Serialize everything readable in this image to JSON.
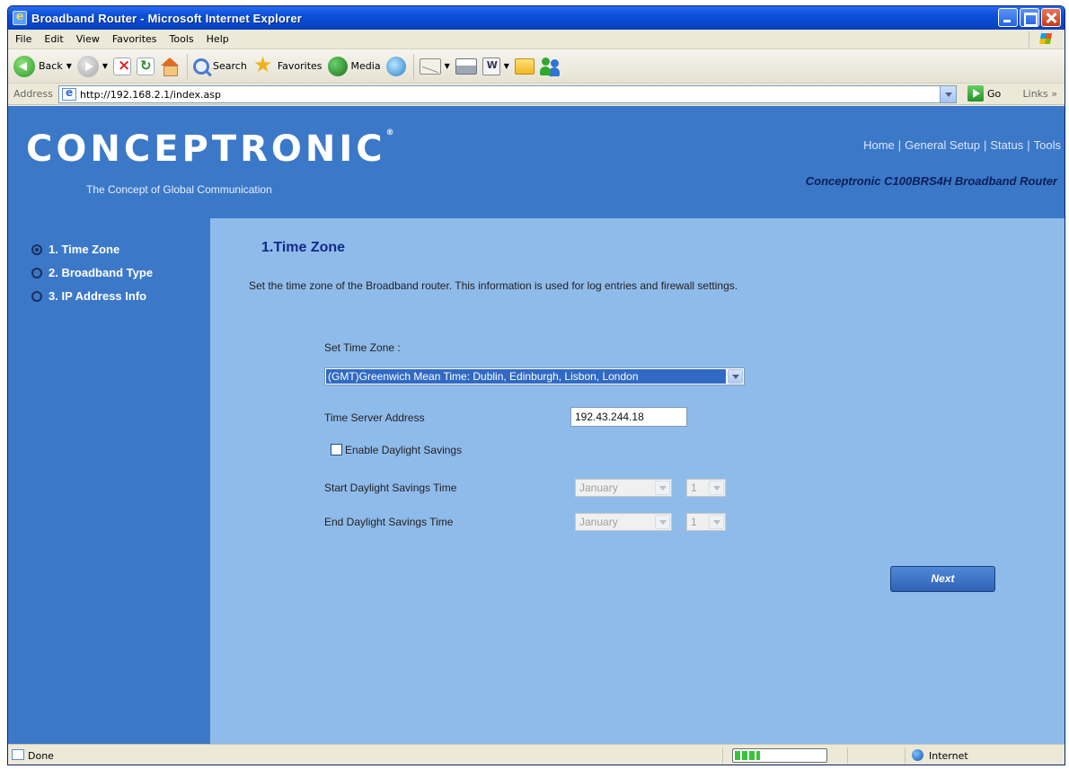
{
  "window": {
    "title": "Broadband Router - Microsoft Internet Explorer"
  },
  "menu": [
    "File",
    "Edit",
    "View",
    "Favorites",
    "Tools",
    "Help"
  ],
  "toolbar": {
    "back_label": "Back",
    "search_label": "Search",
    "favorites_label": "Favorites",
    "media_label": "Media"
  },
  "address": {
    "label": "Address",
    "url": "http://192.168.2.1/index.asp",
    "go_label": "Go",
    "links_label": "Links »"
  },
  "header": {
    "logo_text": "CONCEPTRONIC",
    "tagline": "The Concept of Global Communication",
    "nav": [
      "Home",
      "General Setup",
      "Status",
      "Tools"
    ],
    "model": "Conceptronic C100BRS4H Broadband Router"
  },
  "sidebar": {
    "items": [
      {
        "label": "1. Time Zone",
        "checked": true
      },
      {
        "label": "2. Broadband Type",
        "checked": false
      },
      {
        "label": "3. IP Address Info",
        "checked": false
      }
    ]
  },
  "main": {
    "heading": "1.Time Zone",
    "description": "Set the time zone of the Broadband router. This information is used for log entries and firewall settings.",
    "set_tz_label": "Set Time Zone :",
    "tz_value": "(GMT)Greenwich Mean Time: Dublin, Edinburgh, Lisbon, London",
    "time_server_label": "Time Server Address",
    "time_server_value": "192.43.244.18",
    "daylight_label": "Enable Daylight Savings",
    "start_label": "Start Daylight Savings Time",
    "end_label": "End Daylight Savings Time",
    "start_month": "January",
    "start_day": "1",
    "end_month": "January",
    "end_day": "1",
    "next_label": "Next"
  },
  "status": {
    "left": "Done",
    "zone": "Internet"
  },
  "colors": {
    "header_blue": "#3b78c8",
    "content_blue": "#8fbbea",
    "heading_navy": "#0f2a8a",
    "select_highlight": "#316ac5"
  }
}
